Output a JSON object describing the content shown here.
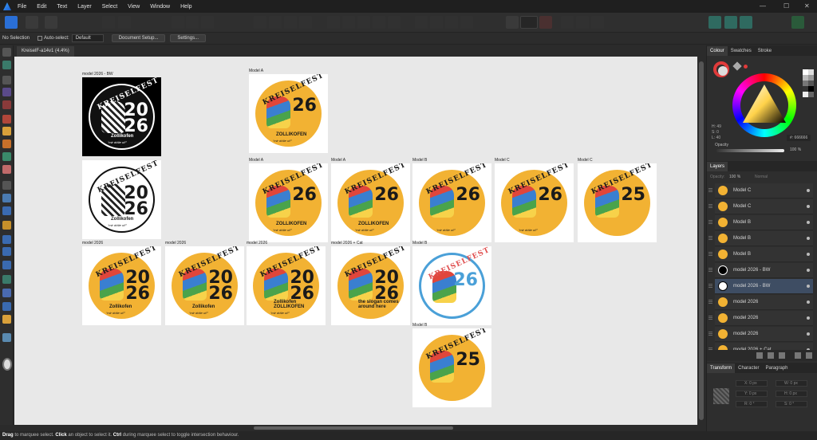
{
  "menu": {
    "items": [
      "File",
      "Edit",
      "Text",
      "Layer",
      "Select",
      "View",
      "Window",
      "Help"
    ],
    "window_controls": [
      "—",
      "☐",
      "✕"
    ]
  },
  "context_bar": {
    "selection": "No Selection",
    "auto_select_label": "Auto-select:",
    "auto_select_value": "Default",
    "document_setup": "Document Setup...",
    "settings": "Settings..."
  },
  "document": {
    "tab_title": "KreiselF-a14v1 (4.4%)"
  },
  "artboards": [
    {
      "label": "model 2026 - BW",
      "num": "20\n26",
      "word": "KREISELFEST",
      "town": "Zollikofen",
      "slogan": "“mir dräie uf!”",
      "style": "bw"
    },
    {
      "label": "Model A",
      "num": "26",
      "word": "KREISELFEST",
      "town": "ZOLLIKOFEN",
      "slogan": "“mir dräie uf!”",
      "style": "color"
    },
    {
      "label": "",
      "num": "20\n26",
      "word": "KREISELFEST",
      "town": "Zollikofen",
      "slogan": "“mir dräie uf!”",
      "style": "bw2"
    },
    {
      "label": "Model A",
      "num": "26",
      "word": "KREISELFEST",
      "town": "ZOLLIKOFEN",
      "slogan": "“mir dräie uf!”",
      "style": "color"
    },
    {
      "label": "Model A",
      "num": "26",
      "word": "KREISELFEST",
      "town": "ZOLLIKOFEN",
      "slogan": "“mir dräie uf!”",
      "style": "color"
    },
    {
      "label": "Model B",
      "num": "26",
      "word": "KREISELFEST",
      "town": "",
      "slogan": "“mir dräie uf!”",
      "style": "color"
    },
    {
      "label": "Model C",
      "num": "26",
      "word": "KREISELFEST",
      "town": "",
      "slogan": "“mir dräie uf!”",
      "style": "color"
    },
    {
      "label": "Model C",
      "num": "25",
      "word": "KREISELFEST",
      "town": "",
      "slogan": "",
      "style": "color"
    },
    {
      "label": "model 2026",
      "num": "20\n26",
      "word": "KREISELFEST",
      "town": "Zollikofen",
      "slogan": "“mir dräie uf!”",
      "style": "color"
    },
    {
      "label": "model 2026",
      "num": "20\n26",
      "word": "KREISELFEST",
      "town": "Zollikofen",
      "slogan": "“mir dräie uf!”",
      "style": "color"
    },
    {
      "label": "model 2026",
      "num": "20\n26",
      "word": "KREISELFEST",
      "town": "Zollikofen ZOLLIKOFEN",
      "slogan": "“mir dräie uf!”",
      "style": "color"
    },
    {
      "label": "model 2026 + Cat",
      "num": "20\n26",
      "word": "KREISELFEST",
      "town": "the slogan comes around here",
      "slogan": "",
      "style": "color"
    },
    {
      "label": "Model B",
      "num": "26",
      "word": "KREISELFEST",
      "town": "",
      "slogan": "",
      "style": "light"
    },
    {
      "label": "Model B",
      "num": "25",
      "word": "KREISELFEST",
      "town": "",
      "slogan": "",
      "style": "color"
    }
  ],
  "right_panel": {
    "colour_tabs": [
      "Colour",
      "Swatches",
      "Stroke"
    ],
    "hsl": [
      "H: 49",
      "S: 0",
      "L: 40"
    ],
    "hex": "#: 666666",
    "opacity_label": "Opacity",
    "opacity_value": "100 %",
    "layers_tab": "Layers",
    "layers_opacity": "100 %",
    "layers_blend": "Normal",
    "layers_opacity_label": "Opacity:",
    "layers": [
      {
        "name": "Model C",
        "thumb": "color",
        "selected": false
      },
      {
        "name": "Model C",
        "thumb": "color",
        "selected": false
      },
      {
        "name": "Model B",
        "thumb": "color",
        "selected": false
      },
      {
        "name": "Model B",
        "thumb": "color",
        "selected": false
      },
      {
        "name": "Model B",
        "thumb": "color",
        "selected": false
      },
      {
        "name": "model 2026 - BW",
        "thumb": "bw",
        "selected": false
      },
      {
        "name": "model 2026 - BW",
        "thumb": "bw2",
        "selected": true
      },
      {
        "name": "model 2026",
        "thumb": "color",
        "selected": false
      },
      {
        "name": "model 2026",
        "thumb": "color",
        "selected": false
      },
      {
        "name": "model 2026",
        "thumb": "color",
        "selected": false
      },
      {
        "name": "model 2026 + Cat",
        "thumb": "color",
        "selected": false
      }
    ],
    "bottom_tabs": [
      "Transform",
      "Character",
      "Paragraph"
    ],
    "transform_fields": [
      {
        "label": "X:",
        "value": "0 px"
      },
      {
        "label": "W:",
        "value": "0 px"
      },
      {
        "label": "Y:",
        "value": "0 px"
      },
      {
        "label": "H:",
        "value": "0 px"
      },
      {
        "label": "R:",
        "value": "0 °"
      },
      {
        "label": "S:",
        "value": "0 °"
      }
    ]
  },
  "status": {
    "drag": "Drag",
    "t1": " to marquee select. ",
    "click": "Click",
    "t2": " an object to select it. ",
    "ctrl": "Ctrl",
    "t3": " during marquee select to toggle intersection behaviour."
  }
}
